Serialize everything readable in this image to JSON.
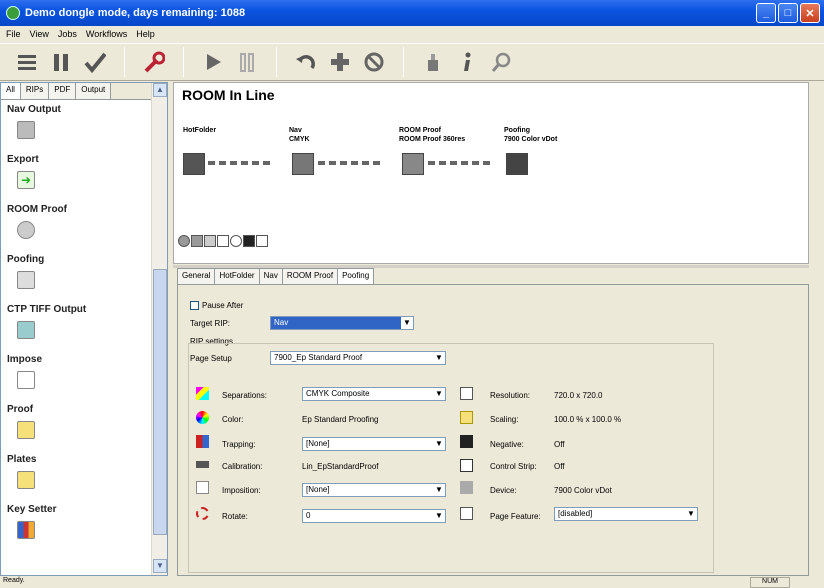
{
  "window": {
    "title": "Demo dongle mode, days remaining: 1088"
  },
  "menu": [
    "File",
    "View",
    "Jobs",
    "Workflows",
    "Help"
  ],
  "toolbar_icons": [
    "menu-list-icon",
    "pause-icon",
    "check-icon",
    "wrench-icon",
    "play-icon",
    "pause-bars-icon",
    "undo-icon",
    "plus-icon",
    "cancel-icon",
    "bucket-icon",
    "info-icon",
    "search-icon"
  ],
  "left_tabs": [
    "All",
    "RIPs",
    "PDF",
    "Output"
  ],
  "left_items": [
    {
      "label": "Nav Output",
      "icon": "nav-output-icon"
    },
    {
      "label": "Export",
      "icon": "export-icon"
    },
    {
      "label": "ROOM Proof",
      "icon": "room-proof-icon"
    },
    {
      "label": "Poofing",
      "icon": "printer-icon"
    },
    {
      "label": "CTP TIFF Output",
      "icon": "ctp-icon"
    },
    {
      "label": "Impose",
      "icon": "impose-icon"
    },
    {
      "label": "Proof",
      "icon": "proof-icon"
    },
    {
      "label": "Plates",
      "icon": "plates-icon"
    },
    {
      "label": "Key Setter",
      "icon": "key-setter-icon"
    }
  ],
  "workflow": {
    "title": "ROOM In Line",
    "nodes": [
      {
        "line1": "HotFolder",
        "line2": ""
      },
      {
        "line1": "Nav",
        "line2": "CMYK"
      },
      {
        "line1": "ROOM Proof",
        "line2": "ROOM Proof 360res"
      },
      {
        "line1": "Poofing",
        "line2": "7900 Color vDot"
      }
    ]
  },
  "tabs": [
    "General",
    "HotFolder",
    "Nav",
    "ROOM Proof",
    "Poofing"
  ],
  "settings": {
    "pause_after": "Pause After",
    "target_rip_label": "Target RIP:",
    "target_rip_value": "Nav",
    "rip_settings_label": "RIP settings",
    "page_setup_label": "Page Setup",
    "page_setup_value": "7900_Ep Standard Proof",
    "left_rows": [
      {
        "label": "Separations:",
        "value": "CMYK Composite",
        "combo": true
      },
      {
        "label": "Color:",
        "value": "Ep Standard Proofing",
        "combo": false
      },
      {
        "label": "Trapping:",
        "value": "[None]",
        "combo": true
      },
      {
        "label": "Calibration:",
        "value": "Lin_EpStandardProof",
        "combo": false
      },
      {
        "label": "Imposition:",
        "value": "[None]",
        "combo": true
      },
      {
        "label": "Rotate:",
        "value": "0",
        "combo": true
      }
    ],
    "right_rows": [
      {
        "label": "Resolution:",
        "value": "720.0 x 720.0"
      },
      {
        "label": "Scaling:",
        "value": "100.0 % x 100.0 %"
      },
      {
        "label": "Negative:",
        "value": "Off"
      },
      {
        "label": "Control Strip:",
        "value": "Off"
      },
      {
        "label": "Device:",
        "value": "7900 Color vDot"
      },
      {
        "label": "Page Feature:",
        "value": "[disabled]"
      }
    ]
  },
  "status": {
    "text": "Ready.",
    "num": "NUM"
  }
}
